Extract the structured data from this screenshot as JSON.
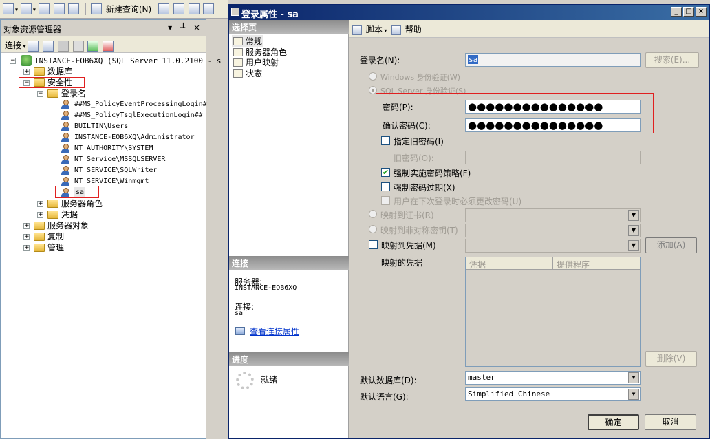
{
  "toolbar": {
    "new_query": "新建查询(N)"
  },
  "object_explorer": {
    "title": "对象资源管理器",
    "controls": "▾ ╨ ×",
    "connect_label": "连接",
    "tree": {
      "root": "INSTANCE-EOB6XQ (SQL Server 11.0.2100 - s",
      "databases": "数据库",
      "security": "安全性",
      "logins": "登录名",
      "login_items": [
        "##MS_PolicyEventProcessingLogin#",
        "##MS_PolicyTsqlExecutionLogin##",
        "BUILTIN\\Users",
        "INSTANCE-EOB6XQ\\Administrator",
        "NT AUTHORITY\\SYSTEM",
        "NT Service\\MSSQLSERVER",
        "NT SERVICE\\SQLWriter",
        "NT SERVICE\\Winmgmt",
        "sa"
      ],
      "server_roles": "服务器角色",
      "credentials": "凭据",
      "server_objects": "服务器对象",
      "replication": "复制",
      "management": "管理"
    }
  },
  "dialog": {
    "title": "登录属性 - sa",
    "select_page": {
      "header": "选择页",
      "items": [
        "常规",
        "服务器角色",
        "用户映射",
        "状态"
      ]
    },
    "connection": {
      "header": "连接",
      "server_label": "服务器:",
      "server_value": "INSTANCE-EOB6XQ",
      "connection_label": "连接:",
      "connection_value": "sa",
      "view_props_link": "查看连接属性"
    },
    "progress": {
      "header": "进度",
      "status": "就绪"
    },
    "script_label": "脚本",
    "help_label": "帮助",
    "form": {
      "login_name_label": "登录名(N):",
      "login_name_value": "sa",
      "search_button": "搜索(E)...",
      "windows_auth": "Windows 身份验证(W)",
      "sql_auth": "SQL Server 身份验证(S)",
      "password_label": "密码(P):",
      "password_value": "●●●●●●●●●●●●●●●",
      "confirm_label": "确认密码(C):",
      "confirm_value": "●●●●●●●●●●●●●●●",
      "specify_old": "指定旧密码(I)",
      "old_password_label": "旧密码(O):",
      "enforce_policy": "强制实施密码策略(F)",
      "enforce_expiration": "强制密码过期(X)",
      "must_change": "用户在下次登录时必须更改密码(U)",
      "map_cert": "映射到证书(R)",
      "map_asym_key": "映射到非对称密钥(T)",
      "map_credential": "映射到凭据(M)",
      "add_button": "添加(A)",
      "mapped_credentials": "映射的凭据",
      "col_credential": "凭据",
      "col_provider": "提供程序",
      "remove_button": "删除(V)",
      "default_db_label": "默认数据库(D):",
      "default_db_value": "master",
      "default_lang_label": "默认语言(G):",
      "default_lang_value": "Simplified Chinese"
    },
    "ok_button": "确定",
    "cancel_button": "取消"
  }
}
